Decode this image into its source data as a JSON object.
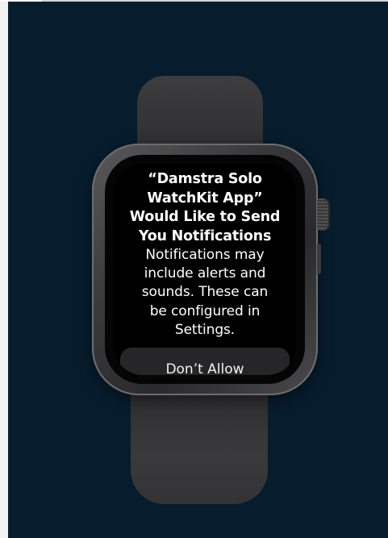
{
  "alert": {
    "title": "“Damstra Solo\nWatchKit App”\nWould Like to Send\nYou Notifications",
    "body": "Notifications may\ninclude alerts and\nsounds. These can\nbe configured in\nSettings.",
    "dont_allow_label": "Don’t Allow"
  },
  "colors": {
    "background": "#071c2d",
    "screen": "#000000",
    "button": "#262628",
    "text": "#ffffff"
  },
  "icons": {
    "crown": "digital-crown-icon"
  }
}
